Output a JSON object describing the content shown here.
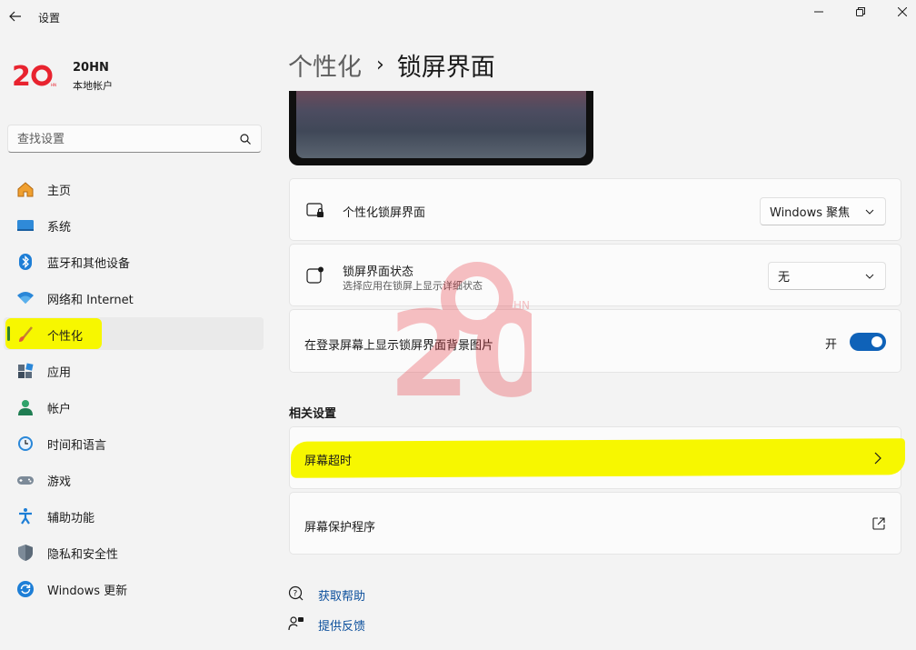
{
  "app": {
    "title": "设置"
  },
  "profile": {
    "name": "20HN",
    "account_type": "本地帐户",
    "avatar_text": "20"
  },
  "search": {
    "placeholder": "查找设置"
  },
  "nav": {
    "items": [
      {
        "label": "主页",
        "icon": "home-icon"
      },
      {
        "label": "系统",
        "icon": "system-icon"
      },
      {
        "label": "蓝牙和其他设备",
        "icon": "bluetooth-icon"
      },
      {
        "label": "网络和 Internet",
        "icon": "wifi-icon"
      },
      {
        "label": "个性化",
        "icon": "brush-icon",
        "active": true
      },
      {
        "label": "应用",
        "icon": "apps-icon"
      },
      {
        "label": "帐户",
        "icon": "account-icon"
      },
      {
        "label": "时间和语言",
        "icon": "clock-globe-icon"
      },
      {
        "label": "游戏",
        "icon": "gamepad-icon"
      },
      {
        "label": "辅助功能",
        "icon": "accessibility-icon"
      },
      {
        "label": "隐私和安全性",
        "icon": "shield-icon"
      },
      {
        "label": "Windows 更新",
        "icon": "update-icon"
      }
    ]
  },
  "breadcrumb": {
    "parent": "个性化",
    "separator": "›",
    "current": "锁屏界面"
  },
  "settings": {
    "personalize_lockscreen": {
      "title": "个性化锁屏界面",
      "value": "Windows 聚焦"
    },
    "lockscreen_status": {
      "title": "锁屏界面状态",
      "subtitle": "选择应用在锁屏上显示详细状态",
      "value": "无"
    },
    "show_background": {
      "title": "在登录屏幕上显示锁屏界面背景图片",
      "state_label": "开",
      "on": true
    }
  },
  "related": {
    "title": "相关设置",
    "screen_timeout": "屏幕超时",
    "screensaver": "屏幕保护程序"
  },
  "help": {
    "get_help": "获取帮助",
    "feedback": "提供反馈"
  },
  "watermark": {
    "text": "20",
    "small": "HN"
  },
  "colors": {
    "accent": "#0f62b8",
    "highlight": "#f7f700",
    "brand_red": "#e8232f"
  }
}
